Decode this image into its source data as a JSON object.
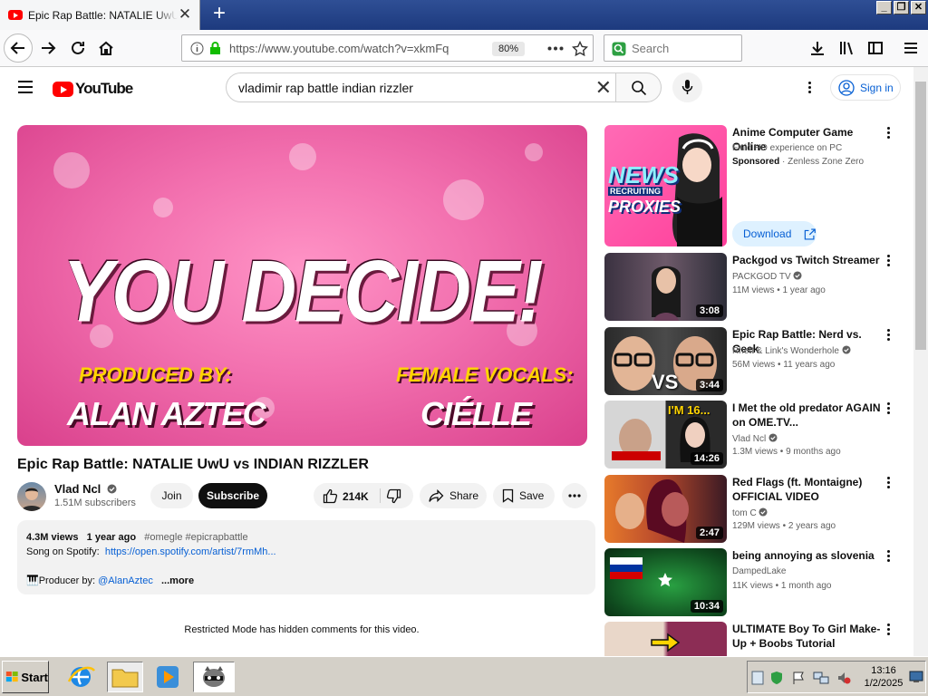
{
  "browser": {
    "tab_title": "Epic Rap Battle: NATALIE UwU vs INDIAN RIZZLER",
    "new_tab": "+",
    "url": "https://www.youtube.com/watch?v=xkmFq",
    "zoom": "80%",
    "search_placeholder": "Search",
    "window_controls": [
      "_",
      "❐",
      "✕"
    ]
  },
  "yt": {
    "logo_text": "YouTube",
    "search_query": "vladimir rap battle indian rizzler",
    "sign_in": "Sign in"
  },
  "player": {
    "headline": "YOU DECIDE!",
    "produced_label": "PRODUCED BY:",
    "produced_name": "ALAN AZTEC",
    "vocals_label": "FEMALE VOCALS:",
    "vocals_name": "CIÉLLE"
  },
  "video": {
    "title": "Epic Rap Battle: NATALIE UwU vs INDIAN RIZZLER",
    "channel": "Vlad Ncl",
    "subscribers": "1.51M subscribers",
    "join": "Join",
    "subscribe": "Subscribe",
    "likes": "214K",
    "share": "Share",
    "save": "Save"
  },
  "description": {
    "views": "4.3M views",
    "age": "1 year ago",
    "tags": "#omegle #epicrapbattle",
    "spotify_label": "Song on Spotify:",
    "spotify_link": "https://open.spotify.com/artist/7rmMh...",
    "producer_label": "🎹Producer by:",
    "producer_link": "@AlanAztec",
    "more": "...more"
  },
  "comments_notice": "Restricted Mode has hidden comments for this video.",
  "recommendations": [
    {
      "title": "Anime Computer Game Online",
      "line2": "Fluid HD experience on PC",
      "sponsored": "Sponsored",
      "advertiser": "· Zenless Zone Zero",
      "cta": "Download",
      "thumb_text_1": "NEWS",
      "thumb_text_2": "RECRUITING",
      "thumb_text_3": "PROXIES"
    },
    {
      "title": "Packgod vs Twitch Streamer",
      "channel": "PACKGOD TV",
      "views": "11M views • 1 year ago",
      "duration": "3:08"
    },
    {
      "title": "Epic Rap Battle: Nerd vs. Geek",
      "channel": "Rhett & Link's Wonderhole",
      "views": "56M views • 11 years ago",
      "duration": "3:44",
      "thumb_text": "VS"
    },
    {
      "title": "I Met the old predator AGAIN on OME.TV...",
      "channel": "Vlad Ncl",
      "views": "1.3M views • 9 months ago",
      "duration": "14:26",
      "thumb_text": "I'M 16..."
    },
    {
      "title": "Red Flags (ft. Montaigne) OFFICIAL VIDEO",
      "channel": "tom C",
      "views": "129M views • 2 years ago",
      "duration": "2:47"
    },
    {
      "title": "being annoying as slovenia",
      "channel": "DampedLake",
      "views": "11K views • 1 month ago",
      "duration": "10:34"
    },
    {
      "title": "ULTIMATE Boy To Girl Make-Up + Boobs Tutorial",
      "channel": "",
      "views": "",
      "duration": ""
    }
  ],
  "taskbar": {
    "start": "Start",
    "time": "13:16",
    "date": "1/2/2025"
  },
  "colors": {
    "yt_red": "#ff0000",
    "link_blue": "#065fd4",
    "titlebar_blue": "#1d3a7e",
    "taskbar_gray": "#d4d0c8"
  }
}
